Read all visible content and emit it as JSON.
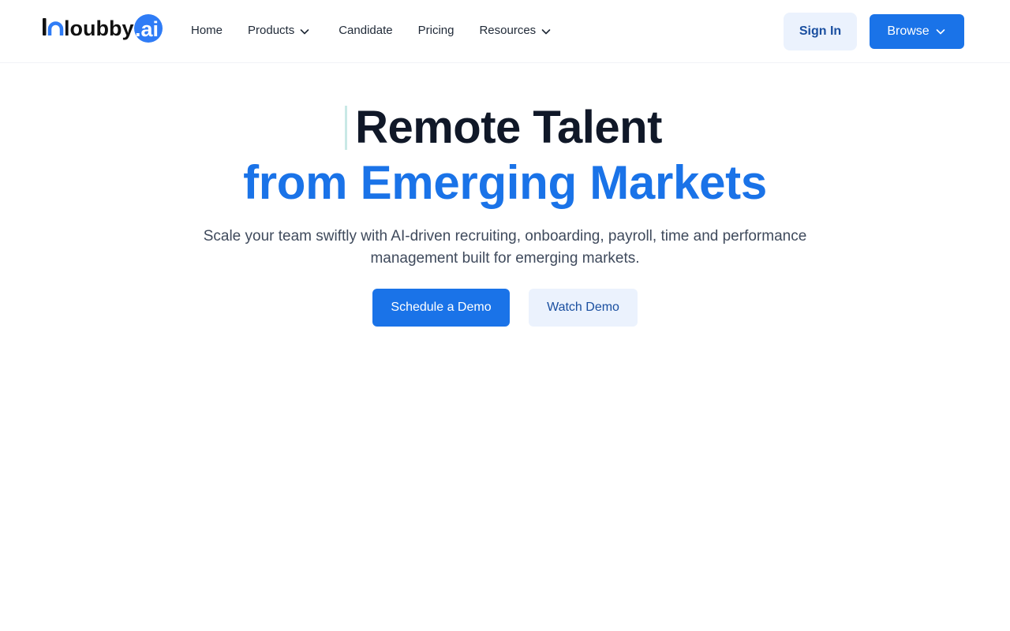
{
  "brand": {
    "wordmark": "loubby",
    "badge": ".ai",
    "colors": {
      "dark": "#111111",
      "accent": "#2f7cf6"
    }
  },
  "nav": {
    "items": [
      {
        "label": "Home",
        "has_dropdown": false
      },
      {
        "label": "Products",
        "has_dropdown": true
      },
      {
        "label": "Candidate",
        "has_dropdown": false
      },
      {
        "label": "Pricing",
        "has_dropdown": false
      },
      {
        "label": "Resources",
        "has_dropdown": true
      }
    ],
    "dropdown_icon": "chevron-down-icon"
  },
  "header_actions": {
    "signin_label": "Sign In",
    "browse_label": "Browse",
    "browse_icon": "chevron-down-icon"
  },
  "hero": {
    "title_line1": "Remote Talent",
    "title_line2": "from Emerging Markets",
    "subtitle": "Scale your team swiftly with AI-driven recruiting, onboarding, payroll, time and performance management built for emerging markets.",
    "primary_cta": "Schedule a Demo",
    "secondary_cta": "Watch Demo"
  },
  "theme": {
    "primary": "#1a73e8",
    "primary_soft": "#ebf2fd",
    "title_dark": "#101828",
    "body_text": "#3f4a5c",
    "cursor_color": "#c9e9e6"
  }
}
